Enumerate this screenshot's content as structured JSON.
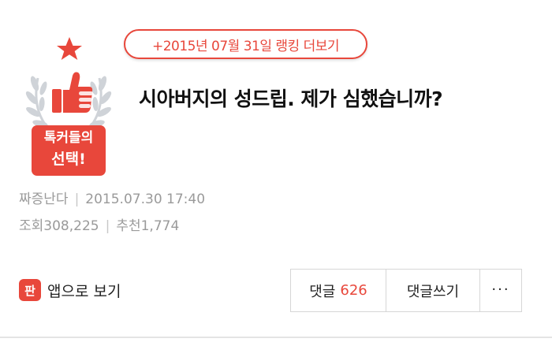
{
  "ranking": {
    "label": "+2015년 07월 31일 랭킹 더보기"
  },
  "badge": {
    "line1": "톡커들의",
    "line2": "선택!"
  },
  "post": {
    "title": "시아버지의 성드립. 제가 심했습니까?",
    "author": "짜증난다",
    "datetime": "2015.07.30 17:40",
    "views_label": "조회",
    "views": "308,225",
    "likes_label": "추천",
    "likes": "1,774"
  },
  "actions": {
    "app_icon_char": "판",
    "app_view": "앱으로 보기",
    "comments_label": "댓글",
    "comments_count": "626",
    "write_comment": "댓글쓰기",
    "more": "···"
  },
  "colors": {
    "accent": "#e8473b",
    "meta_text": "#9a9a9a"
  }
}
